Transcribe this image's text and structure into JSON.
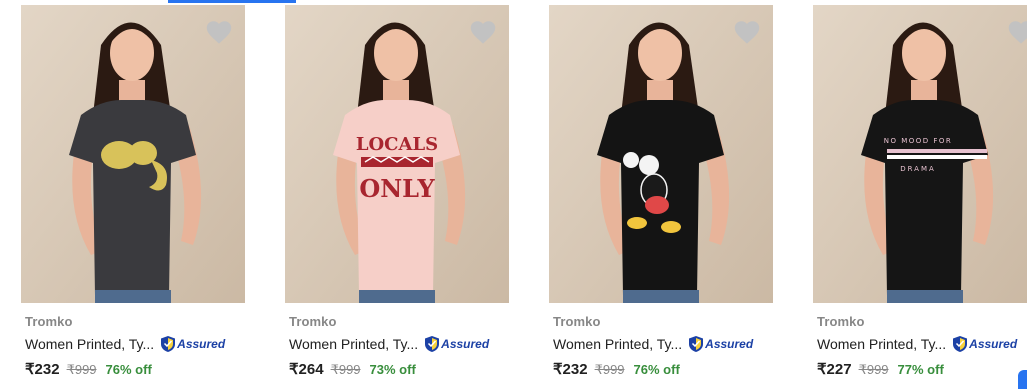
{
  "colors": {
    "accent": "#2874f0",
    "discount_green": "#388e3c",
    "assured_blue": "#1c41a5"
  },
  "products": [
    {
      "brand": "Tromko",
      "title": "Women Printed, Ty...",
      "assured_label": "Assured",
      "price": "₹232",
      "mrp": "₹999",
      "discount": "76% off",
      "tshirt_color": "#3a3a3e",
      "print": "elephant"
    },
    {
      "brand": "Tromko",
      "title": "Women Printed, Ty...",
      "assured_label": "Assured",
      "price": "₹264",
      "mrp": "₹999",
      "discount": "73% off",
      "tshirt_color": "#f6cfc8",
      "print": "locals-only",
      "print_text": [
        "LOCALS",
        "ONLY"
      ]
    },
    {
      "brand": "Tromko",
      "title": "Women Printed, Ty...",
      "assured_label": "Assured",
      "price": "₹232",
      "mrp": "₹999",
      "discount": "76% off",
      "tshirt_color": "#141414",
      "print": "mickey"
    },
    {
      "brand": "Tromko",
      "title": "Women Printed, Ty...",
      "assured_label": "Assured",
      "price": "₹227",
      "mrp": "₹999",
      "discount": "77% off",
      "tshirt_color": "#151515",
      "print": "stripes",
      "print_text": [
        "NO MOOD FOR",
        "DRAMA"
      ]
    }
  ]
}
